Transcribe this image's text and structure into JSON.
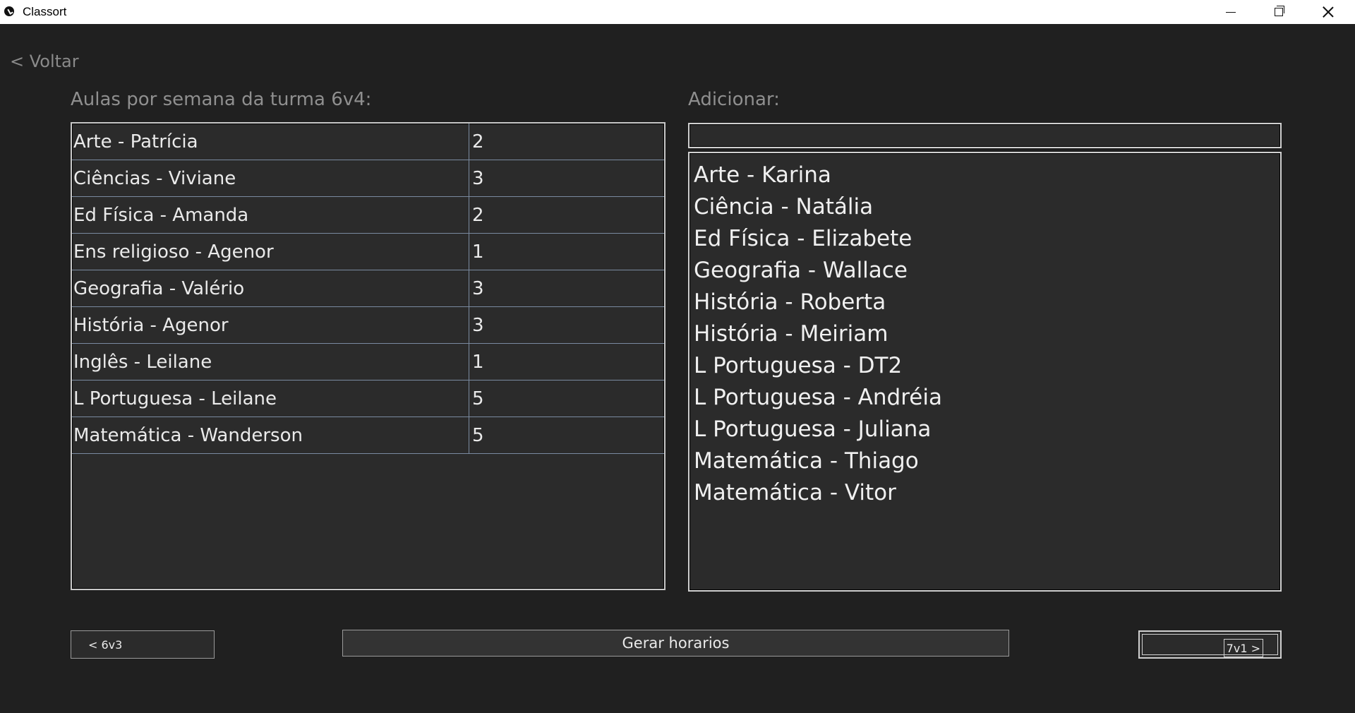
{
  "window": {
    "title": "Classort",
    "icons": [
      "app-icon",
      "minimize-icon",
      "maximize-icon",
      "close-icon"
    ]
  },
  "nav": {
    "back_label": "< Voltar"
  },
  "schedule": {
    "heading": "Aulas por semana da turma 6v4:",
    "rows": [
      {
        "subject": "Arte - Patrícia",
        "count": "2"
      },
      {
        "subject": "Ciências - Viviane",
        "count": "3"
      },
      {
        "subject": "Ed Física - Amanda",
        "count": "2"
      },
      {
        "subject": "Ens religioso - Agenor",
        "count": "1"
      },
      {
        "subject": "Geografia - Valério",
        "count": "3"
      },
      {
        "subject": "História - Agenor",
        "count": "3"
      },
      {
        "subject": "Inglês - Leilane",
        "count": "1"
      },
      {
        "subject": "L Portuguesa - Leilane",
        "count": "5"
      },
      {
        "subject": "Matemática - Wanderson",
        "count": "5"
      }
    ]
  },
  "add": {
    "heading": "Adicionar:",
    "search_value": "",
    "items": [
      "Arte - Karina",
      "Ciência  - Natália",
      "Ed Física - Elizabete",
      "Geografia - Wallace",
      "História - Roberta",
      "História - Meiriam",
      "L Portuguesa - DT2",
      "L Portuguesa - Andréia",
      "L Portuguesa - Juliana",
      "Matemática - Thiago",
      "Matemática - Vitor"
    ]
  },
  "footer": {
    "prev_label": "< 6v3",
    "generate_label": "Gerar horarios",
    "next_label": "7v1 >"
  },
  "colors": {
    "background": "#202020",
    "panel": "#2b2b2b",
    "border": "#c8c8c8",
    "text": "#e6e6e6",
    "muted": "#8f8f8f"
  }
}
